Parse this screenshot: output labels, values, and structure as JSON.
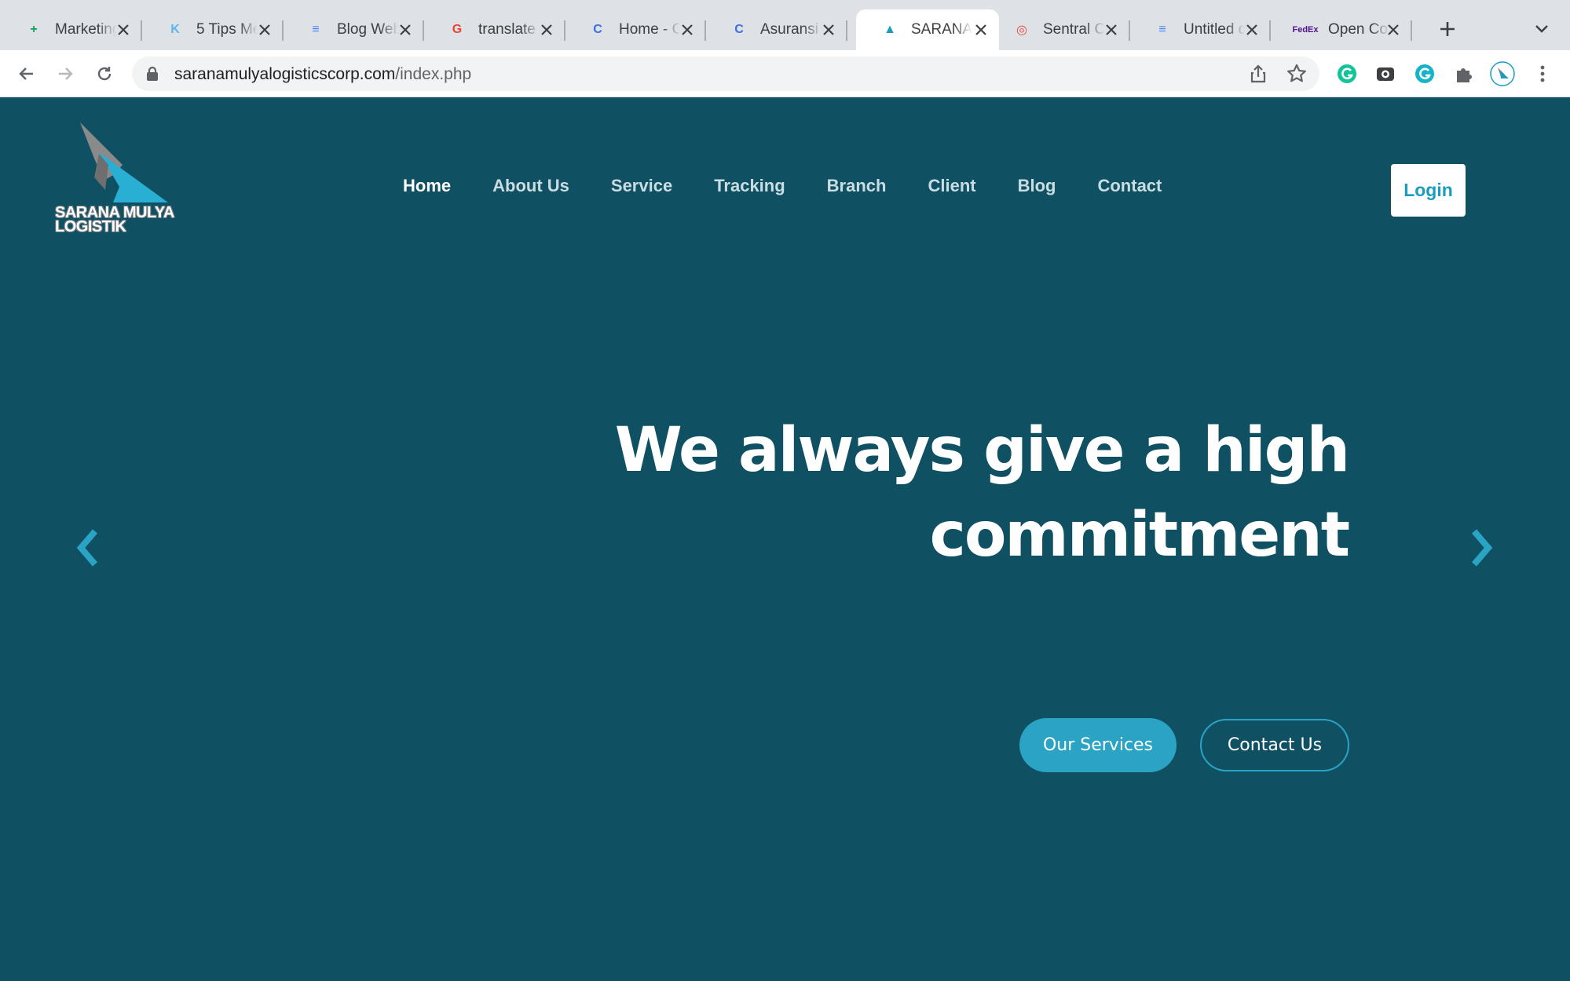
{
  "browser": {
    "tabs": [
      {
        "title": "Marketing",
        "favicon": "google-sheets-icon",
        "color": "#0f9d58",
        "glyph": "+"
      },
      {
        "title": "5 Tips Me",
        "favicon": "brand-k-icon",
        "color": "#5ab7e8",
        "glyph": "K"
      },
      {
        "title": "Blog Web",
        "favicon": "google-docs-icon",
        "color": "#4285f4",
        "glyph": "≡"
      },
      {
        "title": "translate",
        "favicon": "google-icon",
        "color": "#ea4335",
        "glyph": "G"
      },
      {
        "title": "Home - C",
        "favicon": "canva-icon",
        "color": "#3b6fe0",
        "glyph": "C"
      },
      {
        "title": "Asuransi",
        "favicon": "canva-icon",
        "color": "#3b6fe0",
        "glyph": "C"
      },
      {
        "title": "SARANA",
        "favicon": "sarana-logo-icon",
        "color": "#1a9bc0",
        "glyph": "▲",
        "active": true
      },
      {
        "title": "Sentral C",
        "favicon": "sentral-icon",
        "color": "#e84c3d",
        "glyph": "◎"
      },
      {
        "title": "Untitled d",
        "favicon": "google-docs-icon",
        "color": "#4285f4",
        "glyph": "≡"
      },
      {
        "title": "Open Co",
        "favicon": "fedex-icon",
        "color": "#4d148c",
        "glyph": "FedEx"
      }
    ],
    "url": {
      "domain": "saranamulyalogisticscorp.com",
      "path": "/index.php"
    }
  },
  "site": {
    "logo": {
      "line1": "SARANA MULYA",
      "line2": "LOGISTIK"
    },
    "nav": [
      {
        "label": "Home",
        "active": true
      },
      {
        "label": "About Us"
      },
      {
        "label": "Service"
      },
      {
        "label": "Tracking"
      },
      {
        "label": "Branch"
      },
      {
        "label": "Client"
      },
      {
        "label": "Blog"
      },
      {
        "label": "Contact"
      }
    ],
    "login_label": "Login",
    "hero": {
      "line1": "We always give a high",
      "line2": "commitment",
      "primary_button": "Our Services",
      "secondary_button": "Contact Us"
    },
    "colors": {
      "background": "#0f5062",
      "accent": "#2aa3c4",
      "nav_text": "#c9dde3"
    }
  }
}
